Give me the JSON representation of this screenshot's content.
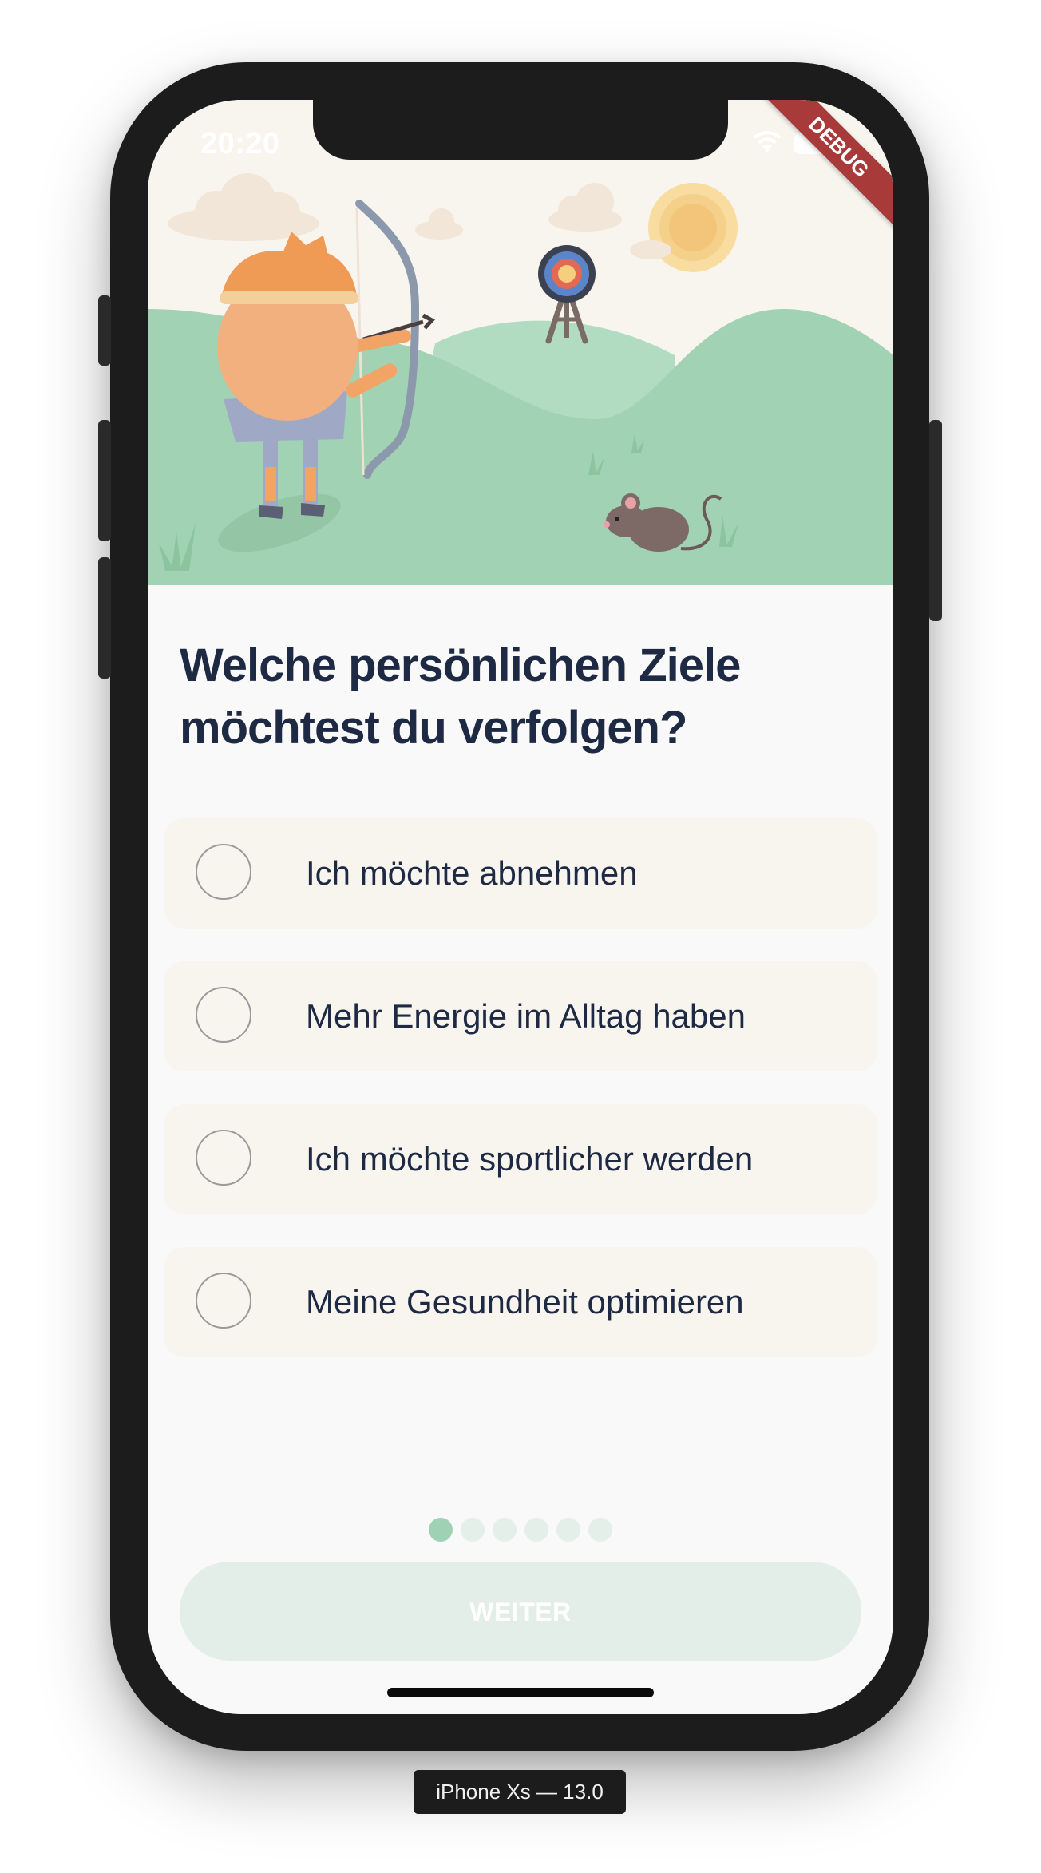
{
  "status_bar": {
    "time": "20:20",
    "debug_label": "DEBUG"
  },
  "question": {
    "title": "Welche persönlichen Ziele möchtest du verfolgen?"
  },
  "options": [
    {
      "label": "Ich möchte abnehmen",
      "selected": false
    },
    {
      "label": "Mehr Energie im Alltag haben",
      "selected": false
    },
    {
      "label": "Ich möchte sportlicher werden",
      "selected": false
    },
    {
      "label": "Meine Gesundheit optimieren",
      "selected": false
    }
  ],
  "pagination": {
    "total": 6,
    "current": 1
  },
  "cta": {
    "label": "WEITER",
    "enabled": false
  },
  "device_label": "iPhone Xs — 13.0",
  "colors": {
    "heading": "#1e2a44",
    "option_bg": "#f8f5ef",
    "hill": "#a1d2b3",
    "accent_dot": "#9fd2b4",
    "button_disabled": "#e4eee9",
    "debug_banner": "#a83a3a"
  },
  "icons": [
    "wifi-icon",
    "battery-icon",
    "archer-illustration",
    "target-icon",
    "mouse-illustration",
    "sun-icon"
  ]
}
